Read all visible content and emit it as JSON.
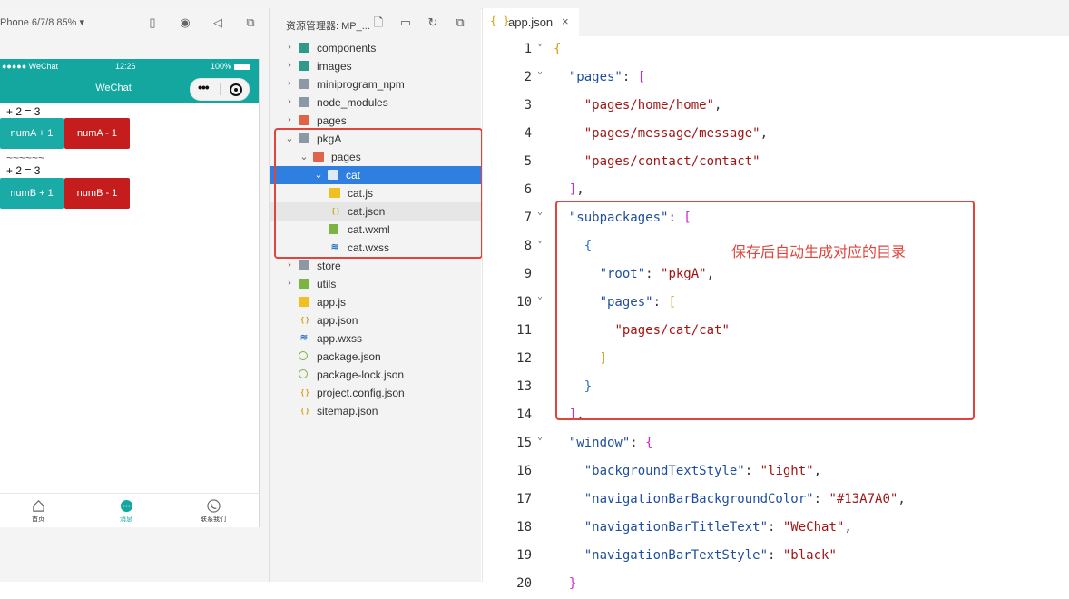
{
  "simulator": {
    "device_label": "Phone 6/7/8 85% ▾",
    "status_left": "●●●●● WeChat",
    "status_time": "12:26",
    "status_battery": "100%",
    "nav_title": "WeChat",
    "line1": "+ 2 = 3",
    "btnA_plus": "numA + 1",
    "btnA_minus": "numA - 1",
    "separator": "~~~~~~",
    "line2": "+ 2 = 3",
    "btnB_plus": "numB + 1",
    "btnB_minus": "numB - 1",
    "tabs": [
      {
        "label": "首页",
        "icon": "home-icon"
      },
      {
        "label": "消息",
        "icon": "message-icon"
      },
      {
        "label": "联系我们",
        "icon": "phone-icon"
      }
    ],
    "colors": {
      "nav": "#13A7A0",
      "teal_button": "#1aaba7",
      "red_button": "#c51d1d"
    }
  },
  "explorer": {
    "title": "资源管理器: MP_...",
    "tree": [
      {
        "label": "components",
        "chevron": "›",
        "icon": "folder-teal",
        "level": 1
      },
      {
        "label": "images",
        "chevron": "›",
        "icon": "folder-teal",
        "level": 1
      },
      {
        "label": "miniprogram_npm",
        "chevron": "›",
        "icon": "folder-gray",
        "level": 1
      },
      {
        "label": "node_modules",
        "chevron": "›",
        "icon": "folder-gray",
        "level": 1
      },
      {
        "label": "pages",
        "chevron": "›",
        "icon": "folder-orange",
        "level": 1
      },
      {
        "label": "pkgA",
        "chevron": "⌄",
        "icon": "folder-gray",
        "level": 1
      },
      {
        "label": "pages",
        "chevron": "⌄",
        "icon": "folder-orange",
        "level": 2
      },
      {
        "label": "cat",
        "chevron": "⌄",
        "icon": "folder-gray",
        "level": 3
      },
      {
        "label": "cat.js",
        "chevron": "",
        "icon": "js-file",
        "level": 4
      },
      {
        "label": "cat.json",
        "chevron": "",
        "icon": "json-file",
        "level": 4
      },
      {
        "label": "cat.wxml",
        "chevron": "",
        "icon": "wxml-file",
        "level": 4
      },
      {
        "label": "cat.wxss",
        "chevron": "",
        "icon": "wxss-file",
        "level": 4
      },
      {
        "label": "store",
        "chevron": "›",
        "icon": "folder-gray",
        "level": 1
      },
      {
        "label": "utils",
        "chevron": "›",
        "icon": "folder-green",
        "level": 1
      },
      {
        "label": "app.js",
        "chevron": "",
        "icon": "js-file",
        "level": 1
      },
      {
        "label": "app.json",
        "chevron": "",
        "icon": "json-file",
        "level": 1
      },
      {
        "label": "app.wxss",
        "chevron": "",
        "icon": "wxss-file",
        "level": 1
      },
      {
        "label": "package.json",
        "chevron": "",
        "icon": "npm-file",
        "level": 1
      },
      {
        "label": "package-lock.json",
        "chevron": "",
        "icon": "npm-file",
        "level": 1
      },
      {
        "label": "project.config.json",
        "chevron": "",
        "icon": "json-file",
        "level": 1
      },
      {
        "label": "sitemap.json",
        "chevron": "",
        "icon": "json-file",
        "level": 1
      }
    ],
    "selected": "cat"
  },
  "editor": {
    "tab_label": "app.json",
    "tab_icon": "{ }",
    "close": "×",
    "annotation": "保存后自动生成对应的目录",
    "lines": [
      {
        "n": "1",
        "fold": true,
        "parts": [
          [
            "b",
            "{"
          ]
        ]
      },
      {
        "n": "2",
        "fold": true,
        "parts": [
          [
            "p",
            "  "
          ],
          [
            "k",
            "\"pages\""
          ],
          [
            "p",
            ": "
          ],
          [
            "b2",
            "["
          ]
        ]
      },
      {
        "n": "3",
        "fold": false,
        "parts": [
          [
            "p",
            "    "
          ],
          [
            "s",
            "\"pages/home/home\""
          ],
          [
            "p",
            ","
          ]
        ]
      },
      {
        "n": "4",
        "fold": false,
        "parts": [
          [
            "p",
            "    "
          ],
          [
            "s",
            "\"pages/message/message\""
          ],
          [
            "p",
            ","
          ]
        ]
      },
      {
        "n": "5",
        "fold": false,
        "parts": [
          [
            "p",
            "    "
          ],
          [
            "s",
            "\"pages/contact/contact\""
          ]
        ]
      },
      {
        "n": "6",
        "fold": false,
        "parts": [
          [
            "p",
            "  "
          ],
          [
            "b2",
            "]"
          ],
          [
            "p",
            ","
          ]
        ]
      },
      {
        "n": "7",
        "fold": true,
        "parts": [
          [
            "p",
            "  "
          ],
          [
            "k",
            "\"subpackages\""
          ],
          [
            "p",
            ": "
          ],
          [
            "b2",
            "["
          ]
        ]
      },
      {
        "n": "8",
        "fold": true,
        "parts": [
          [
            "p",
            "    "
          ],
          [
            "b3",
            "{"
          ]
        ]
      },
      {
        "n": "9",
        "fold": false,
        "parts": [
          [
            "p",
            "      "
          ],
          [
            "k",
            "\"root\""
          ],
          [
            "p",
            ": "
          ],
          [
            "s",
            "\"pkgA\""
          ],
          [
            "p",
            ","
          ]
        ]
      },
      {
        "n": "10",
        "fold": true,
        "parts": [
          [
            "p",
            "      "
          ],
          [
            "k",
            "\"pages\""
          ],
          [
            "p",
            ": "
          ],
          [
            "b",
            "["
          ]
        ]
      },
      {
        "n": "11",
        "fold": false,
        "parts": [
          [
            "p",
            "        "
          ],
          [
            "s",
            "\"pages/cat/cat\""
          ]
        ]
      },
      {
        "n": "12",
        "fold": false,
        "parts": [
          [
            "p",
            "      "
          ],
          [
            "b",
            "]"
          ]
        ]
      },
      {
        "n": "13",
        "fold": false,
        "parts": [
          [
            "p",
            "    "
          ],
          [
            "b3",
            "}"
          ]
        ]
      },
      {
        "n": "14",
        "fold": false,
        "parts": [
          [
            "p",
            "  "
          ],
          [
            "b2",
            "]"
          ],
          [
            "p",
            ","
          ]
        ]
      },
      {
        "n": "15",
        "fold": true,
        "parts": [
          [
            "p",
            "  "
          ],
          [
            "k",
            "\"window\""
          ],
          [
            "p",
            ": "
          ],
          [
            "b2",
            "{"
          ]
        ]
      },
      {
        "n": "16",
        "fold": false,
        "parts": [
          [
            "p",
            "    "
          ],
          [
            "k",
            "\"backgroundTextStyle\""
          ],
          [
            "p",
            ": "
          ],
          [
            "s",
            "\"light\""
          ],
          [
            "p",
            ","
          ]
        ]
      },
      {
        "n": "17",
        "fold": false,
        "parts": [
          [
            "p",
            "    "
          ],
          [
            "k",
            "\"navigationBarBackgroundColor\""
          ],
          [
            "p",
            ": "
          ],
          [
            "s",
            "\"#13A7A0\""
          ],
          [
            "p",
            ","
          ]
        ]
      },
      {
        "n": "18",
        "fold": false,
        "parts": [
          [
            "p",
            "    "
          ],
          [
            "k",
            "\"navigationBarTitleText\""
          ],
          [
            "p",
            ": "
          ],
          [
            "s",
            "\"WeChat\""
          ],
          [
            "p",
            ","
          ]
        ]
      },
      {
        "n": "19",
        "fold": false,
        "parts": [
          [
            "p",
            "    "
          ],
          [
            "k",
            "\"navigationBarTextStyle\""
          ],
          [
            "p",
            ": "
          ],
          [
            "s",
            "\"black\""
          ]
        ]
      },
      {
        "n": "20",
        "fold": false,
        "parts": [
          [
            "p",
            "  "
          ],
          [
            "b2",
            "}"
          ]
        ]
      }
    ]
  }
}
